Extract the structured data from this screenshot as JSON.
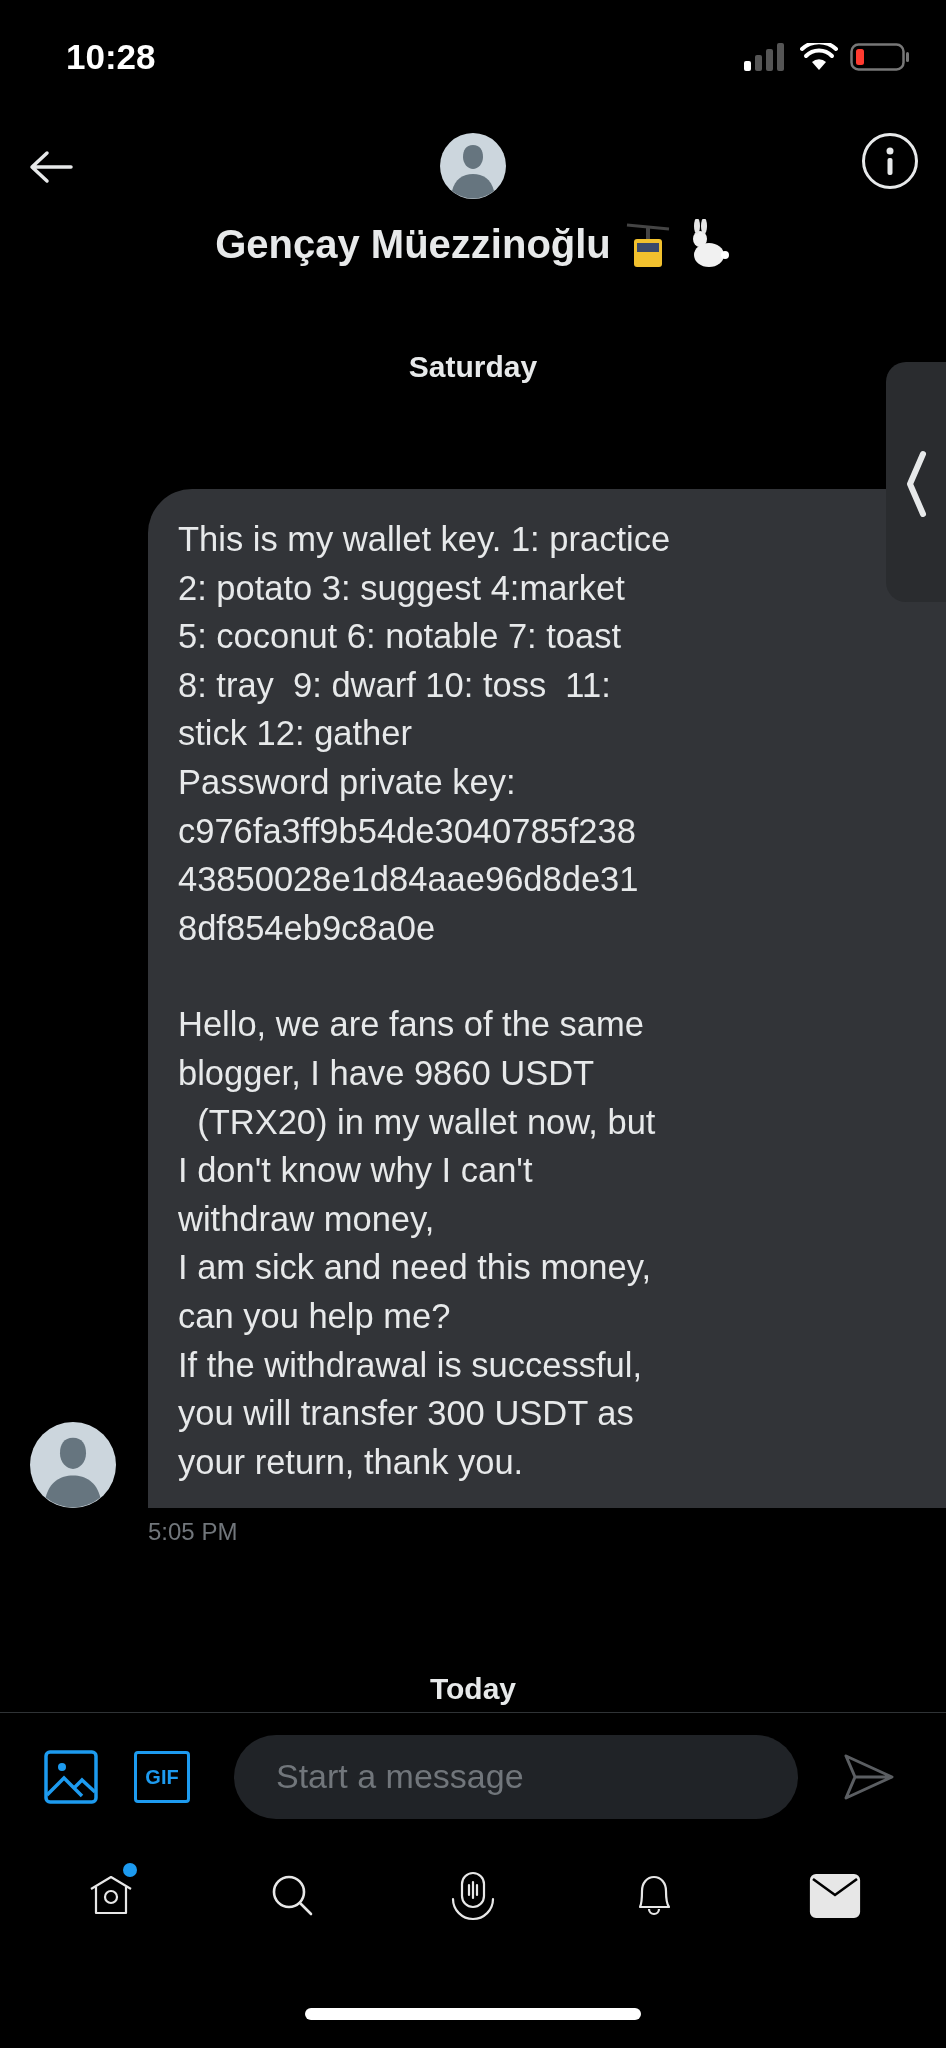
{
  "status_bar": {
    "time": "10:28"
  },
  "header": {
    "name": "Gençay Müezzinoğlu"
  },
  "day_separators": [
    "Saturday",
    "Today"
  ],
  "message": {
    "paragraphs": [
      [
        "This is my wallet key. 1: practice",
        "2: potato 3: suggest 4:market",
        "5: coconut 6: notable 7: toast",
        "8: tray  9: dwarf 10: toss  11:",
        "stick 12: gather",
        "Password private key:",
        "c976fa3ff9b54de3040785f238",
        "43850028e1d84aae96d8de31",
        "8df854eb9c8a0e"
      ],
      [
        "Hello, we are fans of the same",
        "blogger, I have 9860 USDT",
        "  (TRX20) in my wallet now, but",
        "I don't know why I can't",
        "withdraw money,",
        "I am sick and need this money,",
        "can you help me?",
        "If the withdrawal is successful,",
        "you will transfer 300 USDT as",
        "your return, thank you."
      ]
    ],
    "time": "5:05 PM"
  },
  "composer": {
    "gif_label": "GIF",
    "placeholder": "Start a message"
  },
  "nav": [
    {
      "kind": "home",
      "selected": false,
      "badge": true
    },
    {
      "kind": "search",
      "selected": false,
      "badge": false
    },
    {
      "kind": "spaces",
      "selected": false,
      "badge": false
    },
    {
      "kind": "notifications",
      "selected": false,
      "badge": false
    },
    {
      "kind": "messages",
      "selected": true,
      "badge": false
    }
  ]
}
